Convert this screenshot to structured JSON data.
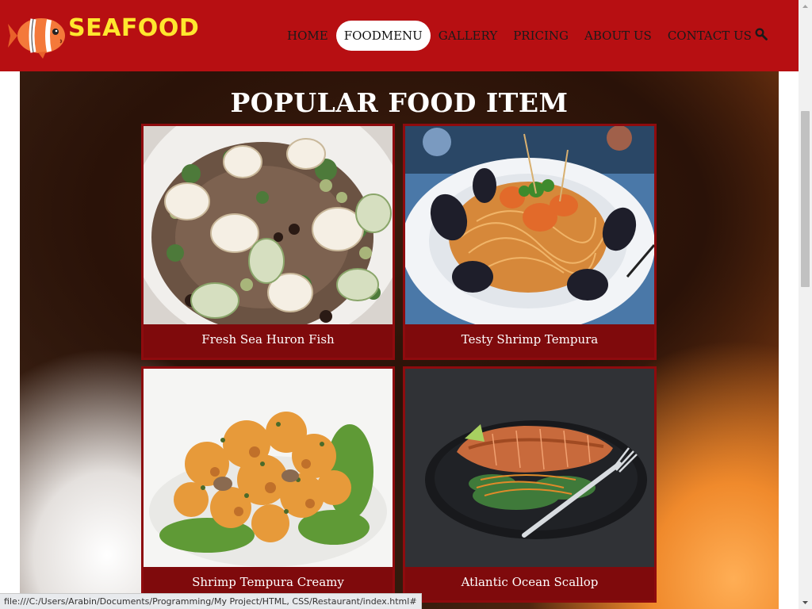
{
  "header": {
    "brand": "SEAFOOD",
    "nav": [
      {
        "label": "HOME",
        "active": false
      },
      {
        "label": "FOODMENU",
        "active": true
      },
      {
        "label": "GALLERY",
        "active": false
      },
      {
        "label": "PRICING",
        "active": false
      },
      {
        "label": "ABOUT US",
        "active": false
      },
      {
        "label": "CONTACT US",
        "active": false
      }
    ],
    "search_icon": "search-icon"
  },
  "section": {
    "title": "POPULAR FOOD ITEM",
    "items": [
      {
        "caption": "Fresh Sea Huron Fish"
      },
      {
        "caption": "Testy Shrimp Tempura"
      },
      {
        "caption": "Shrimp Tempura Creamy"
      },
      {
        "caption": "Atlantic Ocean Scallop"
      }
    ]
  },
  "status_bar": {
    "url": "file:///C:/Users/Arabin/Documents/Programming/My Project/HTML, CSS/Restaurant/index.html#"
  },
  "colors": {
    "header_bg": "#b70f12",
    "brand": "#ffe62e",
    "card_bg": "#7a0a0c"
  }
}
